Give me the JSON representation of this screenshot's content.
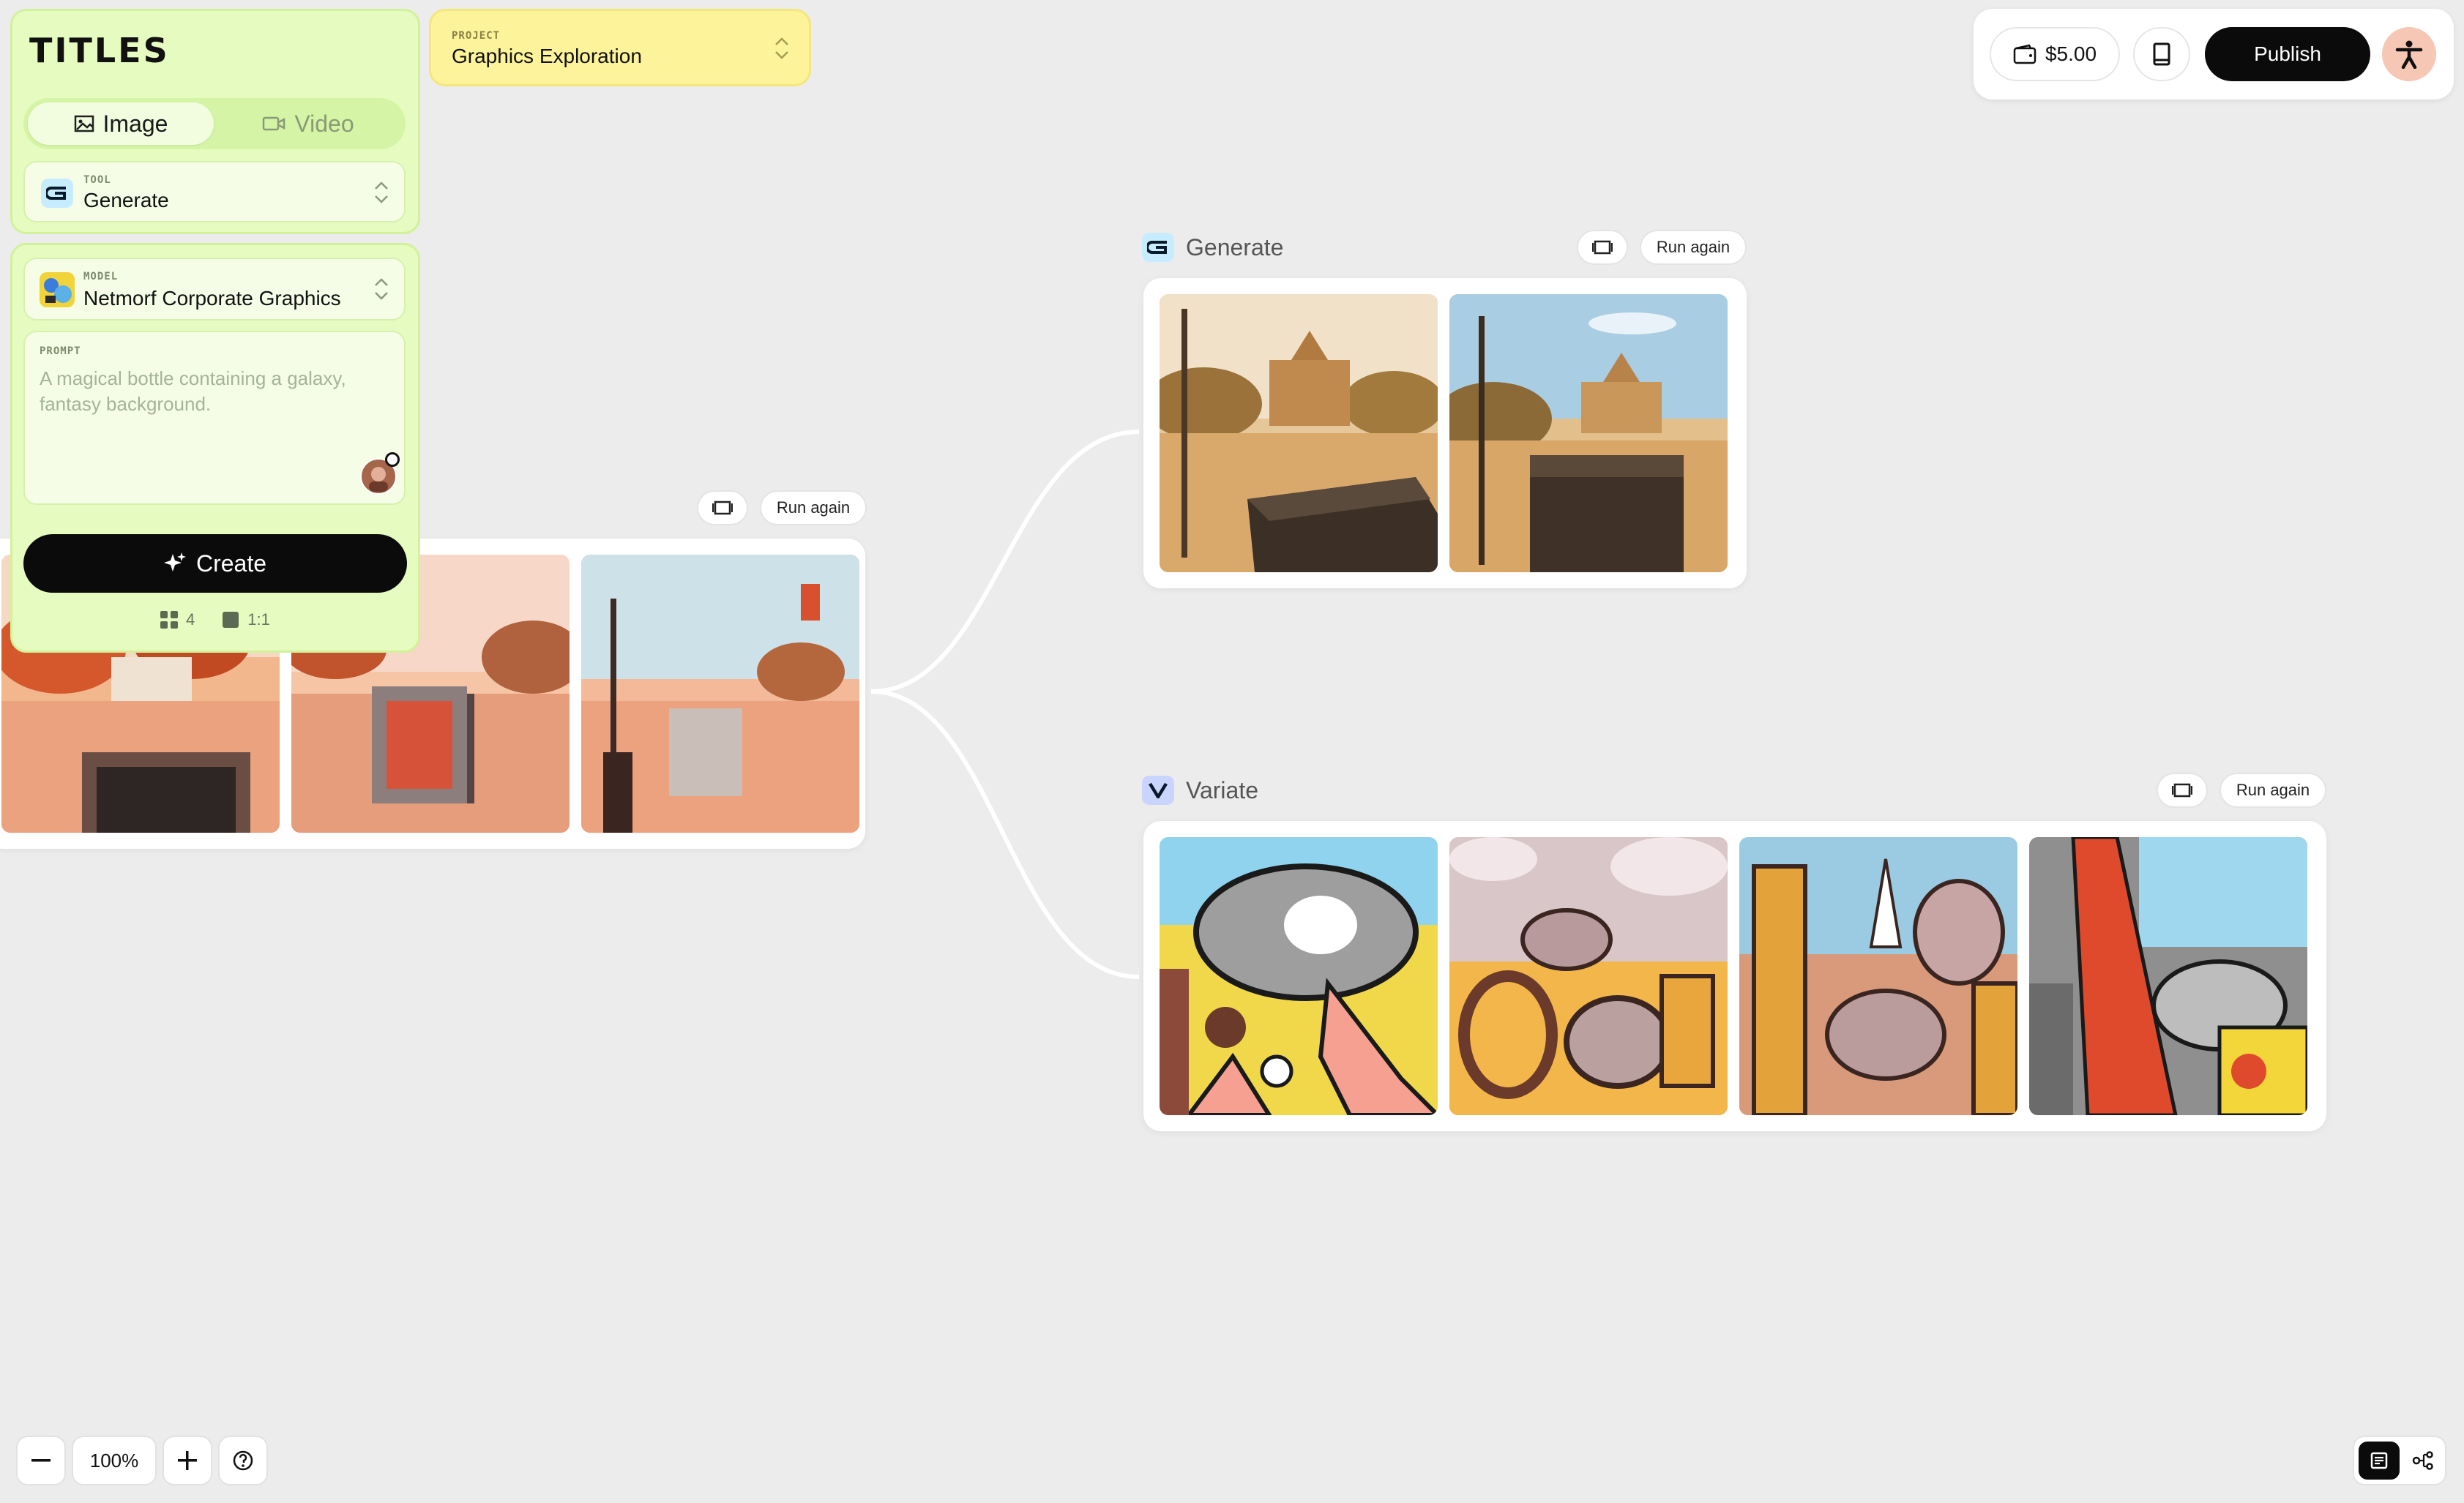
{
  "app": {
    "logo": "TITLES"
  },
  "mode_tabs": [
    {
      "label": "Image",
      "icon": "image-icon",
      "active": true
    },
    {
      "label": "Video",
      "icon": "video-icon",
      "active": false
    }
  ],
  "tool": {
    "label": "TOOL",
    "value": "Generate"
  },
  "model": {
    "label": "MODEL",
    "value": "Netmorf Corporate Graphics"
  },
  "prompt": {
    "label": "PROMPT",
    "placeholder": "A magical bottle containing a galaxy, fantasy background."
  },
  "create": {
    "label": "Create"
  },
  "settings": {
    "count": "4",
    "ratio": "1:1"
  },
  "project": {
    "label": "PROJECT",
    "value": "Graphics Exploration"
  },
  "topbar": {
    "credits": "$5.00",
    "publish_label": "Publish"
  },
  "source_node": {
    "run_again": "Run again"
  },
  "generate_node": {
    "title": "Generate",
    "run_again": "Run again"
  },
  "variate_node": {
    "title": "Variate",
    "run_again": "Run again"
  },
  "zoom": {
    "level": "100%"
  },
  "colors": {
    "panel": "#e6fbbf",
    "project": "#fdf39a",
    "accent_dark": "#0b0b0b",
    "canvas": "#ececec"
  }
}
